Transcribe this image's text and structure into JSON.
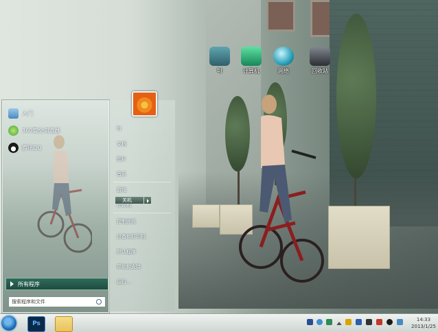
{
  "desktop": {
    "icons": [
      {
        "label": "bj",
        "color": "#2f5f6a"
      },
      {
        "label": "计算机",
        "color": "#17865a"
      },
      {
        "label": "网络",
        "color": "#2aa0b8"
      },
      {
        "label": "回收站",
        "color": "#2c2f34"
      }
    ]
  },
  "start_menu": {
    "pinned": [
      {
        "label": "入门",
        "icon": "getting-started-icon",
        "color": "#4a8bbd"
      },
      {
        "label": "360安全浏览器",
        "icon": "360-browser-icon",
        "color": "#43a047"
      },
      {
        "label": "腾讯QQ",
        "icon": "qq-penguin-icon",
        "color": "#1b1b1b"
      }
    ],
    "all_programs": "所有程序",
    "search_placeholder": "搜索程序和文件",
    "right_items": [
      "bj",
      "文档",
      "图片",
      "音乐",
      "游戏",
      "计算机",
      "控制面板",
      "设备和打印机",
      "默认程序",
      "帮助和支持",
      "运行..."
    ],
    "shutdown_label": "关机"
  },
  "taskbar": {
    "apps": [
      {
        "name": "photoshop",
        "label": "Ps",
        "color": "#0b2a4a"
      },
      {
        "name": "explorer",
        "label": "",
        "color": "#e9c25a"
      }
    ],
    "tray_colors": [
      "#2a4d8f",
      "#3e8ed0",
      "#2e8b57",
      "#d9a300",
      "#2a5fb0",
      "#333333",
      "#c0392b",
      "#1b1b1b"
    ],
    "clock_time": "14:33",
    "clock_date": "2013/1/25"
  }
}
